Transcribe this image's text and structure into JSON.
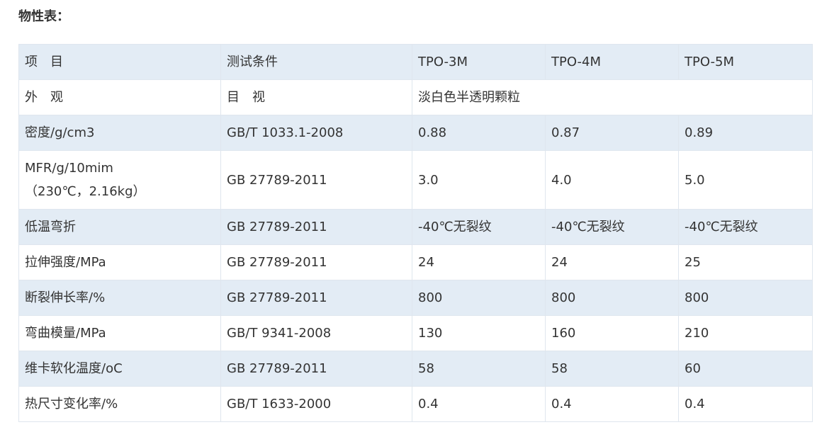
{
  "heading": "物性表：",
  "table": {
    "header": [
      "项　目",
      "测试条件",
      "TPO-3M",
      "TPO-4M",
      "TPO-5M"
    ],
    "appearance": {
      "item": "外　观",
      "condition": "目　视",
      "value": "淡白色半透明颗粒"
    },
    "rows": [
      {
        "item": "密度/g/cm3",
        "condition": "GB/T 1033.1-2008",
        "values": [
          "0.88",
          "0.87",
          "0.89"
        ]
      },
      {
        "item_line1": "MFR/g/10mim",
        "item_line2": "（230℃，2.16kg）",
        "condition": "GB 27789-2011",
        "values": [
          "3.0",
          "4.0",
          "5.0"
        ]
      },
      {
        "item": "低温弯折",
        "condition": "GB 27789-2011",
        "values": [
          "-40℃无裂纹",
          "-40℃无裂纹",
          "-40℃无裂纹"
        ]
      },
      {
        "item": "拉伸强度/MPa",
        "condition": "GB 27789-2011",
        "values": [
          "24",
          "24",
          "25"
        ]
      },
      {
        "item": "断裂伸长率/%",
        "condition": "GB 27789-2011",
        "values": [
          "800",
          "800",
          "800"
        ]
      },
      {
        "item": "弯曲模量/MPa",
        "condition": "GB/T 9341-2008",
        "values": [
          "130",
          "160",
          "210"
        ]
      },
      {
        "item": "维卡软化温度/oC",
        "condition": "GB 27789-2011",
        "values": [
          "58",
          "58",
          "60"
        ]
      },
      {
        "item": "热尺寸变化率/%",
        "condition": "GB/T 1633-2000",
        "values": [
          "0.4",
          "0.4",
          "0.4"
        ]
      }
    ]
  },
  "colors": {
    "shaded_row": "#e3ecf5",
    "border": "#dfe6ee",
    "text": "#333333"
  }
}
